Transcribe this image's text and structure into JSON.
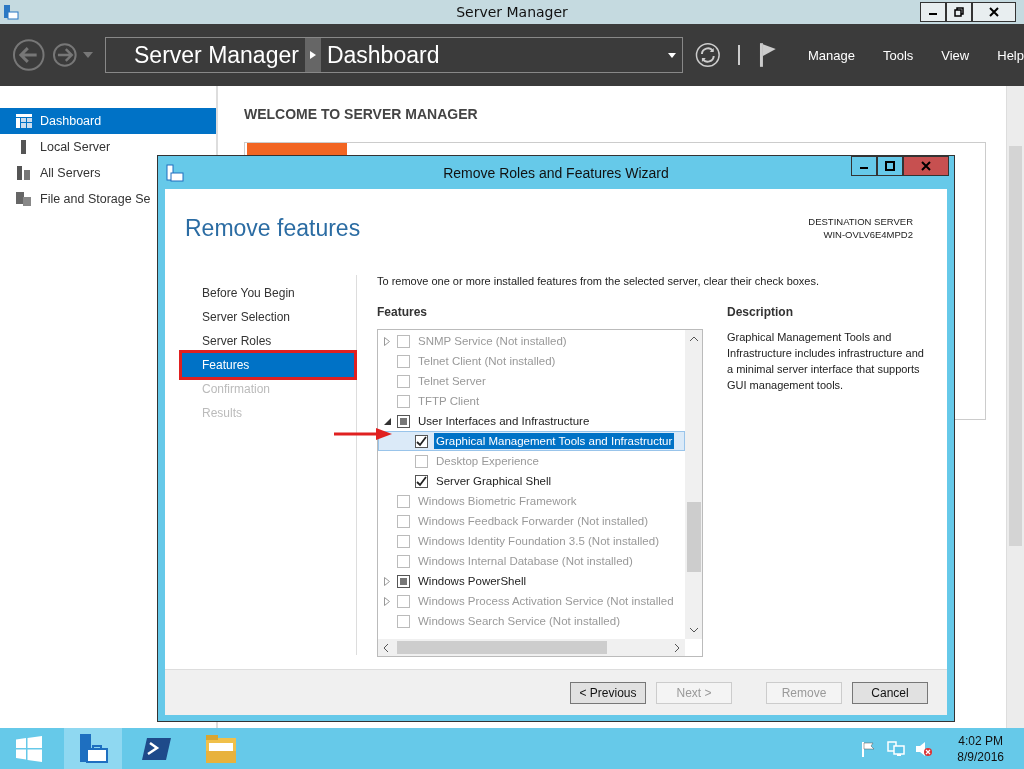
{
  "window": {
    "title": "Server Manager"
  },
  "toolbar": {
    "breadcrumb": [
      "Server Manager",
      "Dashboard"
    ],
    "menus": [
      "Manage",
      "Tools",
      "View",
      "Help"
    ]
  },
  "sidebar": {
    "items": [
      {
        "label": "Dashboard",
        "selected": true
      },
      {
        "label": "Local Server",
        "selected": false
      },
      {
        "label": "All Servers",
        "selected": false
      },
      {
        "label": "File and Storage Se",
        "selected": false
      }
    ]
  },
  "content": {
    "heading": "WELCOME TO SERVER MANAGER"
  },
  "wizard": {
    "title": "Remove Roles and Features Wizard",
    "heading": "Remove features",
    "destination_label": "DESTINATION SERVER",
    "destination_server": "WIN-OVLV6E4MPD2",
    "steps": [
      {
        "label": "Before You Begin",
        "selected": false,
        "disabled": false
      },
      {
        "label": "Server Selection",
        "selected": false,
        "disabled": false
      },
      {
        "label": "Server Roles",
        "selected": false,
        "disabled": false
      },
      {
        "label": "Features",
        "selected": true,
        "disabled": false
      },
      {
        "label": "Confirmation",
        "selected": false,
        "disabled": true
      },
      {
        "label": "Results",
        "selected": false,
        "disabled": true
      }
    ],
    "instruction": "To remove one or more installed features from the selected server, clear their check boxes.",
    "features_label": "Features",
    "features": [
      {
        "label": "SNMP Service (Not installed)",
        "checked": false,
        "disabled": true,
        "expanded": false,
        "selected": false
      },
      {
        "label": "Telnet Client (Not installed)",
        "checked": false,
        "disabled": true,
        "selected": false
      },
      {
        "label": "Telnet Server",
        "checked": false,
        "disabled": true,
        "selected": false
      },
      {
        "label": "TFTP Client",
        "checked": false,
        "disabled": true,
        "selected": false
      },
      {
        "label": "User Interfaces and Infrastructure",
        "checked": false,
        "indeterminate": true,
        "disabled": false,
        "expanded": true,
        "selected": false,
        "children": [
          {
            "label": "Graphical Management Tools and Infrastructur",
            "checked": true,
            "disabled": false,
            "selected": true
          },
          {
            "label": "Desktop Experience",
            "checked": false,
            "disabled": true,
            "selected": false
          },
          {
            "label": "Server Graphical Shell",
            "checked": true,
            "disabled": false,
            "selected": false
          }
        ]
      },
      {
        "label": "Windows Biometric Framework",
        "checked": false,
        "disabled": true,
        "selected": false
      },
      {
        "label": "Windows Feedback Forwarder (Not installed)",
        "checked": false,
        "disabled": true,
        "selected": false
      },
      {
        "label": "Windows Identity Foundation 3.5 (Not installed)",
        "checked": false,
        "disabled": true,
        "selected": false
      },
      {
        "label": "Windows Internal Database (Not installed)",
        "checked": false,
        "disabled": true,
        "selected": false
      },
      {
        "label": "Windows PowerShell",
        "checked": false,
        "indeterminate": true,
        "disabled": false,
        "expanded": false,
        "selected": false
      },
      {
        "label": "Windows Process Activation Service (Not installed",
        "checked": false,
        "disabled": true,
        "expanded": false,
        "selected": false
      },
      {
        "label": "Windows Search Service (Not installed)",
        "checked": false,
        "disabled": true,
        "selected": false
      }
    ],
    "description_label": "Description",
    "description": "Graphical Management Tools and Infrastructure includes infrastructure and a minimal server interface that supports GUI management tools.",
    "buttons": [
      {
        "label": "< Previous",
        "disabled": false
      },
      {
        "label": "Next >",
        "disabled": true
      },
      {
        "label": "Remove",
        "disabled": true
      },
      {
        "label": "Cancel",
        "disabled": false
      }
    ]
  },
  "taskbar": {
    "apps": [
      {
        "selected": true
      },
      {
        "selected": false
      },
      {
        "selected": false
      }
    ],
    "time": "4:02 PM",
    "date": "8/9/2016"
  }
}
